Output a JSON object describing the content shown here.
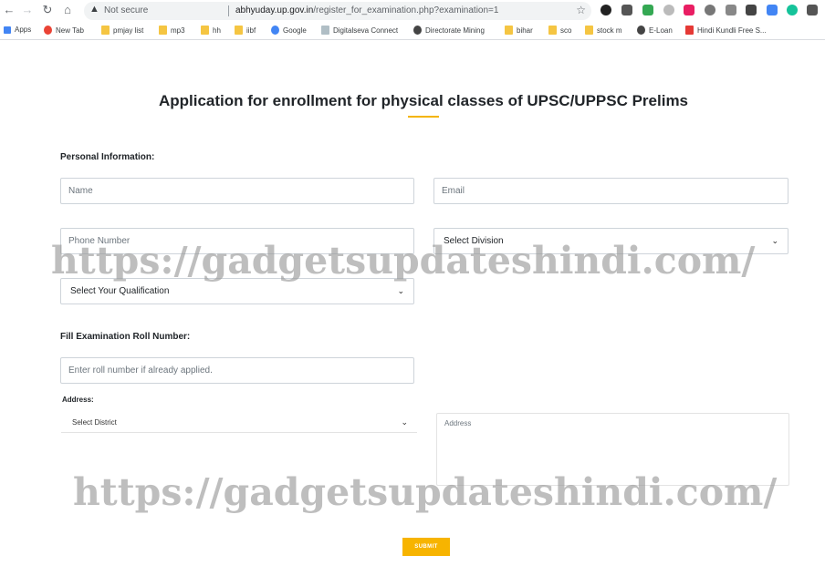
{
  "browser": {
    "security_text": "Not secure",
    "url_host": "abhyuday.up.gov.in",
    "url_path": "/register_for_examination.php?examination=1",
    "bookmarks": [
      {
        "label": "Apps",
        "icon": "apps-grid-icon"
      },
      {
        "label": "New Tab",
        "icon": "new-tab-icon"
      },
      {
        "label": "pmjay list",
        "icon": "folder-icon"
      },
      {
        "label": "mp3",
        "icon": "folder-icon"
      },
      {
        "label": "hh",
        "icon": "folder-icon"
      },
      {
        "label": "iibf",
        "icon": "folder-icon"
      },
      {
        "label": "Google",
        "icon": "google-icon"
      },
      {
        "label": "Digitalseva Connect",
        "icon": "page-icon"
      },
      {
        "label": "Directorate Mining",
        "icon": "globe-icon"
      },
      {
        "label": "bihar",
        "icon": "folder-icon"
      },
      {
        "label": "sco",
        "icon": "folder-icon"
      },
      {
        "label": "stock m",
        "icon": "folder-icon"
      },
      {
        "label": "E-Loan",
        "icon": "globe-icon"
      },
      {
        "label": "Hindi Kundli Free S...",
        "icon": "kundli-icon"
      }
    ]
  },
  "form": {
    "title": "Application for enrollment for physical classes of UPSC/UPPSC Prelims",
    "personal_label": "Personal Information:",
    "name_placeholder": "Name",
    "email_placeholder": "Email",
    "phone_placeholder": "Phone Number",
    "division_selected": "Select Division",
    "qualification_selected": "Select Your Qualification",
    "roll_label": "Fill Examination Roll Number:",
    "roll_placeholder": "Enter roll number if already applied.",
    "address_label": "Address:",
    "district_selected": "Select District",
    "address_placeholder": "Address",
    "submit_label": "SUBMIT"
  },
  "watermark": {
    "text": "https://gadgetsupdateshindi.com/"
  },
  "colors": {
    "accent": "#f7b400",
    "watermark": "#969696"
  }
}
